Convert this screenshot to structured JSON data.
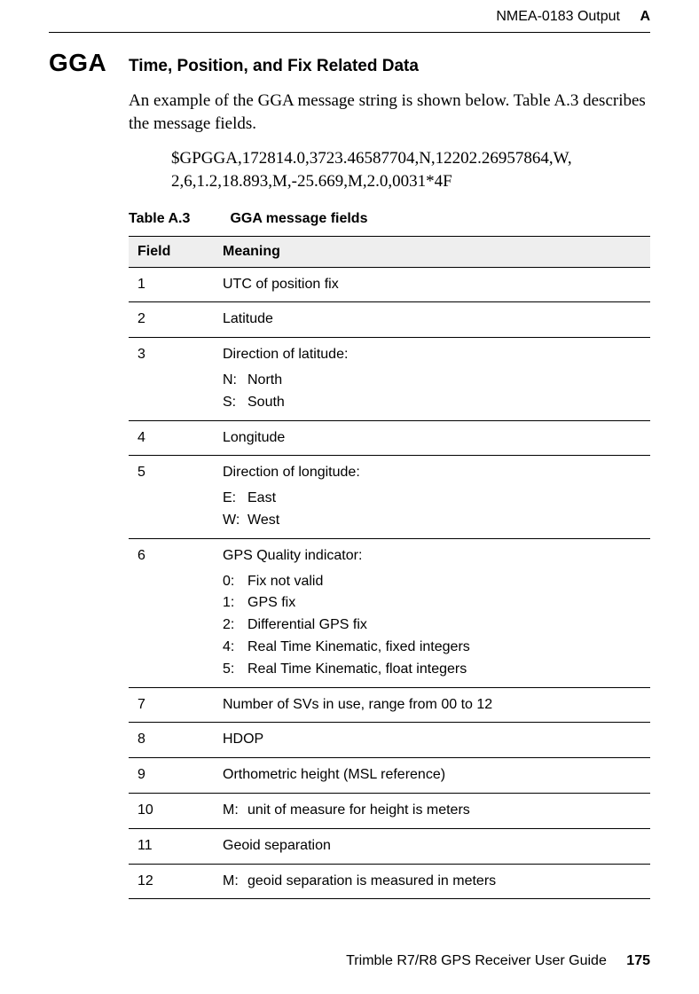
{
  "header": {
    "title": "NMEA-0183 Output",
    "appendix": "A"
  },
  "section": {
    "label": "GGA",
    "title": "Time, Position, and Fix Related Data",
    "intro": "An example of the GGA message string is shown below. Table A.3 describes the message fields.",
    "example_line1": "$GPGGA,172814.0,3723.46587704,N,12202.26957864,W,",
    "example_line2": "2,6,1.2,18.893,M,-25.669,M,2.0,0031*4F"
  },
  "table": {
    "caption_num": "Table A.3",
    "caption_title": "GGA message fields",
    "col_field": "Field",
    "col_meaning": "Meaning",
    "rows": [
      {
        "field": "1",
        "meaning": "UTC of position fix"
      },
      {
        "field": "2",
        "meaning": "Latitude"
      },
      {
        "field": "3",
        "meaning": "Direction of latitude:",
        "sub": [
          {
            "k": "N:",
            "v": "North"
          },
          {
            "k": "S:",
            "v": "South"
          }
        ]
      },
      {
        "field": "4",
        "meaning": "Longitude"
      },
      {
        "field": "5",
        "meaning": "Direction of longitude:",
        "sub": [
          {
            "k": "E:",
            "v": "East"
          },
          {
            "k": "W:",
            "v": "West"
          }
        ]
      },
      {
        "field": "6",
        "meaning": "GPS Quality indicator:",
        "sub": [
          {
            "k": "0:",
            "v": "Fix not valid"
          },
          {
            "k": "1:",
            "v": "GPS fix"
          },
          {
            "k": "2:",
            "v": "Differential GPS fix"
          },
          {
            "k": "4:",
            "v": "Real Time Kinematic, fixed integers"
          },
          {
            "k": "5:",
            "v": "Real Time Kinematic, float integers"
          }
        ]
      },
      {
        "field": "7",
        "meaning": "Number of SVs in use, range from 00 to 12"
      },
      {
        "field": "8",
        "meaning": "HDOP"
      },
      {
        "field": "9",
        "meaning": "Orthometric height (MSL reference)"
      },
      {
        "field": "10",
        "inline_key": "M:",
        "inline_val": "unit of measure for height is meters"
      },
      {
        "field": "11",
        "meaning": "Geoid separation"
      },
      {
        "field": "12",
        "inline_key": "M:",
        "inline_val": "geoid separation is measured in meters"
      }
    ]
  },
  "footer": {
    "guide": "Trimble R7/R8 GPS Receiver User Guide",
    "page": "175"
  }
}
